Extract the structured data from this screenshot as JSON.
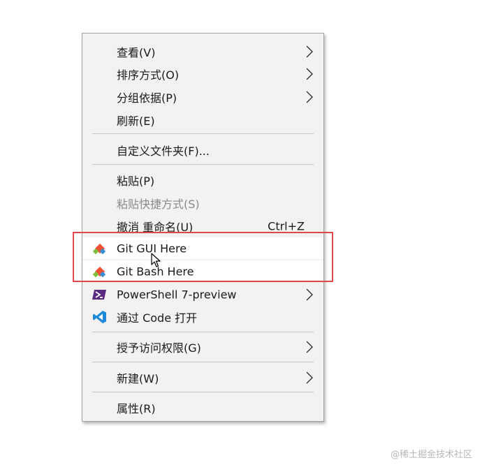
{
  "menu": {
    "items": [
      {
        "label": "查看(V)",
        "submenu": true
      },
      {
        "label": "排序方式(O)",
        "submenu": true
      },
      {
        "label": "分组依据(P)",
        "submenu": true
      },
      {
        "label": "刷新(E)"
      },
      {
        "label": "自定义文件夹(F)..."
      },
      {
        "label": "粘贴(P)"
      },
      {
        "label": "粘贴快捷方式(S)",
        "disabled": true
      },
      {
        "label": "撤消 重命名(U)",
        "shortcut": "Ctrl+Z"
      },
      {
        "label": "Git GUI Here",
        "icon": "git-gui-icon"
      },
      {
        "label": "Git Bash Here",
        "icon": "git-bash-icon"
      },
      {
        "label": "PowerShell 7-preview",
        "icon": "powershell-icon",
        "submenu": true
      },
      {
        "label": "通过 Code 打开",
        "icon": "vscode-icon"
      },
      {
        "label": "授予访问权限(G)",
        "submenu": true
      },
      {
        "label": "新建(W)",
        "submenu": true
      },
      {
        "label": "属性(R)"
      }
    ]
  },
  "colors": {
    "menu_bg": "#f2f2f2",
    "highlight_border": "#e0474c",
    "git_orange": "#f05133",
    "powershell_purple": "#5a2a82",
    "vscode_blue": "#1e88d9"
  },
  "watermark": "@稀土掘金技术社区"
}
